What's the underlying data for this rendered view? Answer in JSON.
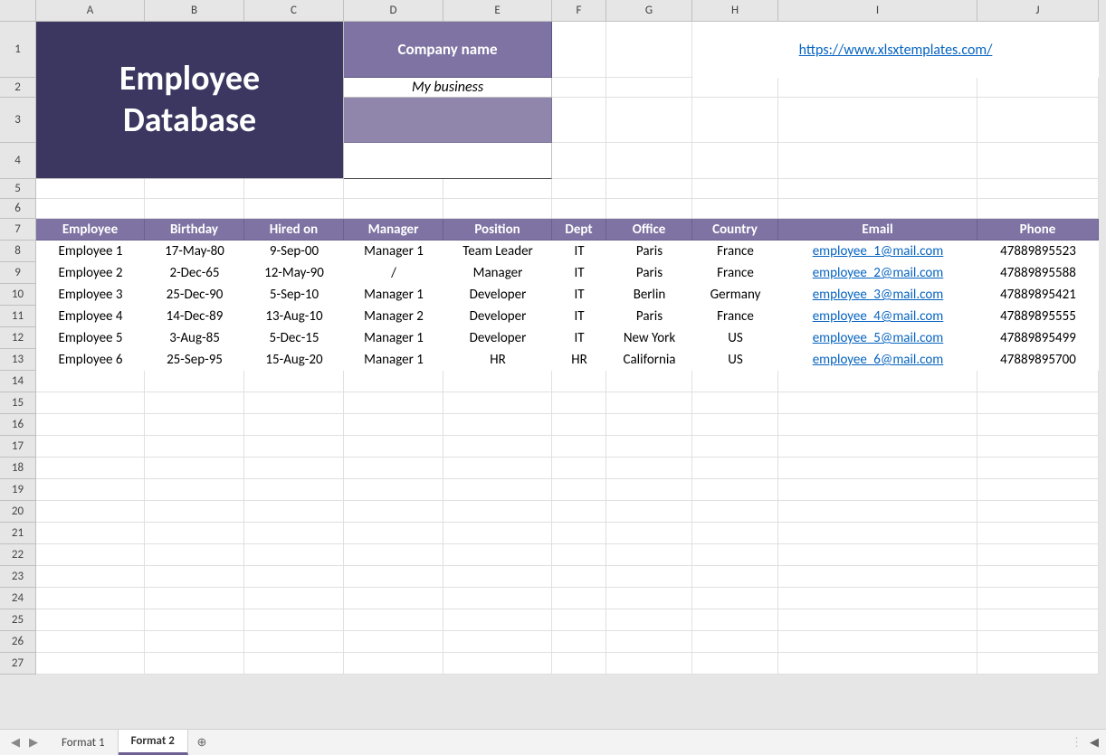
{
  "columns": [
    "A",
    "B",
    "C",
    "D",
    "E",
    "F",
    "G",
    "H",
    "I",
    "J"
  ],
  "rowCount": 27,
  "title": "Employee Database",
  "companyHeader": "Company name",
  "companyName": "My business",
  "link": "https://www.xlsxtemplates.com/",
  "headers": [
    "Employee",
    "Birthday",
    "Hired on",
    "Manager",
    "Position",
    "Dept",
    "Office",
    "Country",
    "Email",
    "Phone"
  ],
  "rows": [
    {
      "employee": "Employee 1",
      "birthday": "17-May-80",
      "hired": "9-Sep-00",
      "manager": "Manager 1",
      "position": "Team Leader",
      "dept": "IT",
      "office": "Paris",
      "country": "France",
      "email": "employee_1@mail.com",
      "phone": "47889895523"
    },
    {
      "employee": "Employee 2",
      "birthday": "2-Dec-65",
      "hired": "12-May-90",
      "manager": "/",
      "position": "Manager",
      "dept": "IT",
      "office": "Paris",
      "country": "France",
      "email": "employee_2@mail.com",
      "phone": "47889895588"
    },
    {
      "employee": "Employee 3",
      "birthday": "25-Dec-90",
      "hired": "5-Sep-10",
      "manager": "Manager 1",
      "position": "Developer",
      "dept": "IT",
      "office": "Berlin",
      "country": "Germany",
      "email": "employee_3@mail.com",
      "phone": "47889895421"
    },
    {
      "employee": "Employee 4",
      "birthday": "14-Dec-89",
      "hired": "13-Aug-10",
      "manager": "Manager 2",
      "position": "Developer",
      "dept": "IT",
      "office": "Paris",
      "country": "France",
      "email": "employee_4@mail.com",
      "phone": "47889895555"
    },
    {
      "employee": "Employee 5",
      "birthday": "3-Aug-85",
      "hired": "5-Dec-15",
      "manager": "Manager 1",
      "position": "Developer",
      "dept": "IT",
      "office": "New York",
      "country": "US",
      "email": "employee_5@mail.com",
      "phone": "47889895499"
    },
    {
      "employee": "Employee 6",
      "birthday": "25-Sep-95",
      "hired": "15-Aug-20",
      "manager": "Manager 1",
      "position": "HR",
      "dept": "HR",
      "office": "California",
      "country": "US",
      "email": "employee_6@mail.com",
      "phone": "47889895700"
    }
  ],
  "tabs": [
    "Format 1",
    "Format 2"
  ],
  "activeTab": 1,
  "icons": {
    "add": "⊕",
    "navFirst": "⏮",
    "navPrev": "◀",
    "navNext": "▶",
    "navLast": "⏭",
    "scrollLeft": "◀"
  }
}
